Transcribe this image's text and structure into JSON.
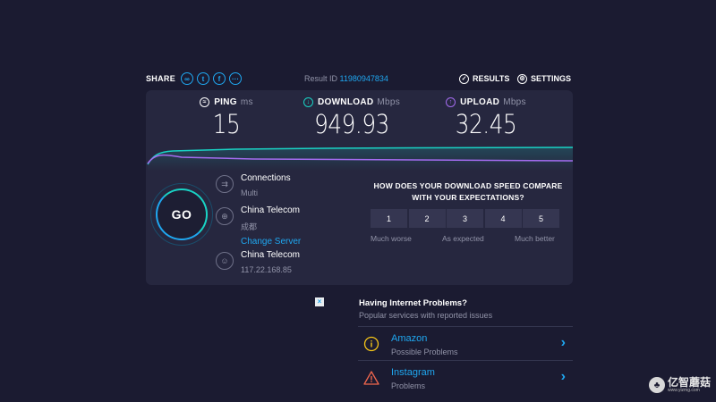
{
  "topbar": {
    "share_label": "SHARE",
    "share_icons": [
      "link-icon",
      "twitter-icon",
      "facebook-icon",
      "more-icon"
    ],
    "result_label": "Result ID",
    "result_id": "11980947834",
    "results_label": "RESULTS",
    "settings_label": "SETTINGS"
  },
  "metrics": {
    "ping": {
      "label": "PING",
      "unit": "ms",
      "value": "15"
    },
    "download": {
      "label": "DOWNLOAD",
      "unit": "Mbps",
      "value": "949.93"
    },
    "upload": {
      "label": "UPLOAD",
      "unit": "Mbps",
      "value": "32.45"
    }
  },
  "colors": {
    "download": "#19d3c5",
    "upload": "#a46cf0",
    "accent": "#1fa7f0",
    "panel": "#26273f"
  },
  "go_label": "GO",
  "connections": {
    "title": "Connections",
    "value": "Multi"
  },
  "server": {
    "name": "China Telecom",
    "location": "成都",
    "change": "Change Server"
  },
  "isp": {
    "name": "China Telecom",
    "ip": "117.22.168.85"
  },
  "survey": {
    "question": "HOW DOES YOUR DOWNLOAD SPEED COMPARE WITH YOUR EXPECTATIONS?",
    "options": [
      "1",
      "2",
      "3",
      "4",
      "5"
    ],
    "label_low": "Much worse",
    "label_mid": "As expected",
    "label_high": "Much better"
  },
  "problems": {
    "title": "Having Internet Problems?",
    "subtitle": "Popular services with reported issues",
    "items": [
      {
        "name": "Amazon",
        "status": "Possible Problems",
        "icon": "info-icon"
      },
      {
        "name": "Instagram",
        "status": "Problems",
        "icon": "warning-icon"
      }
    ]
  },
  "watermark": {
    "text": "亿智蘑菇",
    "url": "www.yizmg.com"
  }
}
